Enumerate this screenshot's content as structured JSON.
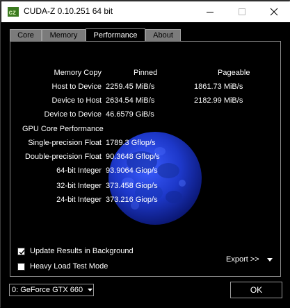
{
  "window": {
    "title": "CUDA-Z 0.10.251 64 bit",
    "app_icon": "cuda-z-logo-icon",
    "controls": [
      "minimize-icon",
      "maximize-icon",
      "close-icon"
    ]
  },
  "tabs": [
    {
      "label": "Core",
      "active": false
    },
    {
      "label": "Memory",
      "active": false
    },
    {
      "label": "Performance",
      "active": true
    },
    {
      "label": "About",
      "active": false
    }
  ],
  "performance": {
    "memory_copy": {
      "label": "Memory Copy",
      "col1_header": "Pinned",
      "col2_header": "Pageable",
      "rows": [
        {
          "label": "Host to Device",
          "pinned": "2259.45 MiB/s",
          "pageable": "1861.73 MiB/s"
        },
        {
          "label": "Device to Host",
          "pinned": "2634.54 MiB/s",
          "pageable": "2182.99 MiB/s"
        },
        {
          "label": "Device to Device",
          "pinned": "46.6579 GiB/s",
          "pageable": ""
        }
      ]
    },
    "gpu_core": {
      "label": "GPU Core Performance",
      "rows": [
        {
          "label": "Single-precision Float",
          "value": "1789.3 Gflop/s"
        },
        {
          "label": "Double-precision Float",
          "value": "90.3648 Gflop/s"
        },
        {
          "label": "64-bit Integer",
          "value": "93.9064 Giop/s"
        },
        {
          "label": "32-bit Integer",
          "value": "373.458 Giop/s"
        },
        {
          "label": "24-bit Integer",
          "value": "373.216 Giop/s"
        }
      ]
    },
    "background_image": "blue-moon-image"
  },
  "options": {
    "update_in_background": {
      "label": "Update Results in Background",
      "checked": true
    },
    "heavy_load": {
      "label": "Heavy Load Test Mode",
      "checked": false
    }
  },
  "export": {
    "label": "Export >>"
  },
  "device_select": {
    "value": "0: GeForce GTX 660"
  },
  "ok_button": {
    "label": "OK"
  },
  "colors": {
    "background": "#000000",
    "text": "#ffffff",
    "moon_blue": "#1f3fd0",
    "inactive_tab": "#7b7b7b"
  }
}
